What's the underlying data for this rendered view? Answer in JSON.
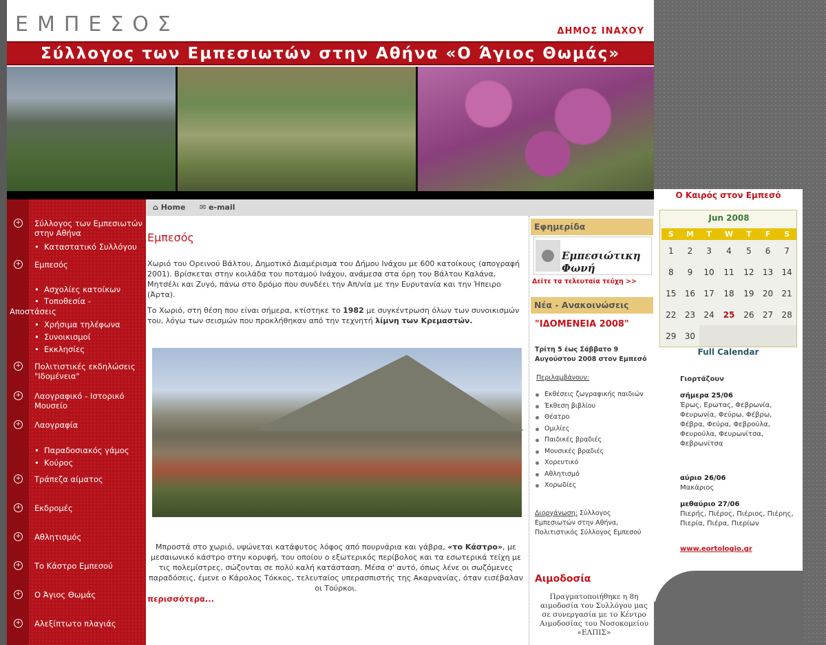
{
  "header": {
    "logo": "ΕΜΠΕΣΟΣ",
    "municipality": "ΔΗΜΟΣ ΙΝΑΧΟΥ",
    "banner": "Σύλλογος των Εμπεσιωτών στην Αθήνα «Ο Άγιος Θωμάς»"
  },
  "topbar": {
    "home": "Home",
    "email": "e-mail"
  },
  "nav": [
    {
      "label": "Σύλλογος των Εμπεσιωτών στην Αθήνα"
    },
    {
      "label": "Καταστατικό Συλλόγου",
      "sub": true
    },
    {
      "label": "Εμπεσός"
    },
    {
      "label": "Ασχολίες κατοίκων",
      "sub": true
    },
    {
      "label": "Τοποθεσία -",
      "sub": true
    },
    {
      "label": "Αποστάσεις"
    },
    {
      "label": "Χρήσιμα τηλέφωνα",
      "sub": true
    },
    {
      "label": "Συνοικισμοί",
      "sub": true
    },
    {
      "label": "Εκκλησίες",
      "sub": true
    },
    {
      "label": "Πολιτιστικές εκδηλώσεις \"Ιδομένεια\""
    },
    {
      "label": "Λαογραφικό - Ιστορικό Μουσείο"
    },
    {
      "label": "Λαογραφία"
    },
    {
      "label": "Παραδοσιακός γάμος",
      "sub": true
    },
    {
      "label": "Κούρος",
      "sub": true
    },
    {
      "label": "Τράπεζα αίματος"
    },
    {
      "label": "Εκδρομές"
    },
    {
      "label": "Αθλητισμός"
    },
    {
      "label": "Το Κάστρο Εμπεσού"
    },
    {
      "label": "Ο Άγιος Θωμάς"
    },
    {
      "label": "Αλεξίπτωτο πλαγιάς"
    }
  ],
  "main": {
    "title": "Εμπεσός",
    "p1": "Χωριό του Ορεινού Βάλτου, Δημοτικό Διαμέρισμα του Δήμου Ινάχου με 600 κατοίκους (απογραφή 2001). Βρίσκεται στην κοιλάδα του ποταμού Ινάχου, ανάμεσα στα όρη του Βάλτου Καλάνα, Μητσέλι και Ζυγό, πάνω στο δρόμο που συνδέει την Απ/νία με την Ευρυτανία και την Ήπειρο (Άρτα).",
    "p2_a": "Το Χωριό, στη θέση που είναι σήμερα, κτίστηκε το ",
    "p2_year": "1982",
    "p2_b": " με συγκέντρωση όλων των συνοικισμών του, λόγω των σεισμών που προκλήθηκαν από την τεχνητή ",
    "p2_lake": "λίμνη των Κρεμαστών.",
    "p3_a": "Μπροστά στο χωριό, υψώνεται κατάφυτος λόφος από πουρνάρια και γάβρα, ",
    "p3_castle": "«το Κάστρο»",
    "p3_b": ", με μεσαιωνικό κάστρο στην κορυφή, του οποίου ο εξωτερικός περίβολος και τα εσωτερικά τείχη με τις πολεμίστρες, σώζονται σε πολύ καλή κατάσταση. Μέσα σ' αυτό, όπως λένε οι σωζόμενες παραδόσεις, έμενε ο Κάρολος Τόκκος, τελευταίος υπερασπιστής της Ακαρνανίας, όταν εισέβαλαν οι Τούρκοι.",
    "more": "περισσότερα..."
  },
  "mid": {
    "newspaper_head": "Εφημερίδα",
    "newspaper_name": "Εμπεσιώτικη Φωνή",
    "newspaper_link": "Δείτε τα τελευταία τεύχη >>",
    "news_head": "Νέα - Ανακοινώσεις",
    "news_title": "\"ΙΔΟΜΕΝΕΙΑ 2008\"",
    "news_dates": "Τρίτη 5 έως Σάββατο 9 Αυγούστου 2008 στον Εμπεσό",
    "includes": "Περιλαμβάνουν:",
    "items": [
      "Εκθέσεις ζωγραφικής παιδιών",
      "Έκθεση βιβλίου",
      "Θέατρο",
      "Ομιλίες",
      "Παιδικές βραδιές",
      "Μουσικές βραδιές",
      "Χορευτικό",
      "Αθλητισμό",
      "Χορωδίες"
    ],
    "organizer_label": "Διοργάνωση:",
    "organizer": " Σύλλογος Εμπεσιωτών στην Αθήνα, Πολιτιστικός Σύλλογος Εμπεσού",
    "blood_title": "Αιμοδοσία",
    "blood_text": "Πραγματοποιήθηκε η 8η αιμοδοσία του Συλλόγου μας σε συνεργασία με το Κέντρο Αιμοδοσίας του Νοσοκομείου «ΕΛΠΙΣ»"
  },
  "right": {
    "weather": "Ο Καιρός στον Εμπεσό",
    "month": "Jun 2008",
    "days": [
      "S",
      "M",
      "T",
      "W",
      "T",
      "F",
      "S"
    ],
    "weeks": [
      [
        "1",
        "2",
        "3",
        "4",
        "5",
        "6",
        "7"
      ],
      [
        "8",
        "9",
        "10",
        "11",
        "12",
        "13",
        "14"
      ],
      [
        "15",
        "16",
        "17",
        "18",
        "19",
        "20",
        "21"
      ],
      [
        "22",
        "23",
        "24",
        "25",
        "26",
        "27",
        "28"
      ],
      [
        "29",
        "30",
        "",
        "",
        "",
        "",
        ""
      ]
    ],
    "today": "25",
    "full_calendar": "Full Calendar",
    "celebrate": "Γιορτάζουν",
    "today_label": "σήμερα 25/06",
    "today_names": "Έρως, Ερωτας, Φεβρωνία, Φευρωνία, Φεύρω, Φέβρω, Φέβρα, Φεύρα, Φεβρούλα, Φευρούλα, Φευρωνίτσα, Φεβρωνίτσα",
    "tomorrow_label": "αύριο 26/06",
    "tomorrow_names": "Μακάριος",
    "after_label": "μεθαύριο 27/06",
    "after_names": "Πιερής, Πιέρος, Πιέριος, Πιέρης, Πιερία, Πιέρα, Πιερίων",
    "eortologio": "www.eortologio.gr"
  }
}
